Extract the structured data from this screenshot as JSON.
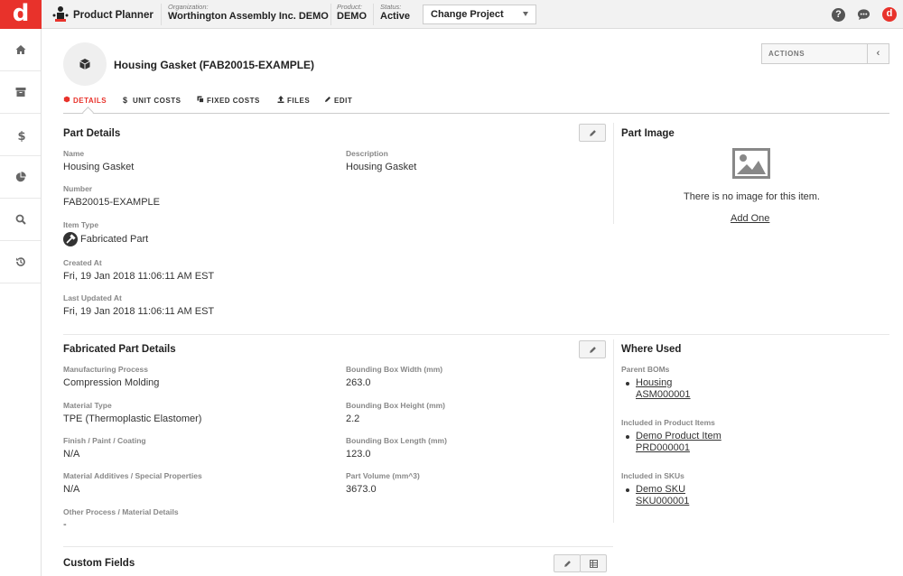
{
  "topbar": {
    "logo": "d",
    "app_name": "Product Planner",
    "organization_label": "Organization:",
    "organization": "Worthington Assembly Inc. DEMO",
    "product_label": "Product:",
    "product": "DEMO",
    "status_label": "Status:",
    "status": "Active",
    "change_project": "Change Project",
    "help": "?",
    "avatar": "d"
  },
  "sidebar": {
    "items": [
      "home-icon",
      "archive-icon",
      "dollar-icon",
      "pie-chart-icon",
      "search-icon",
      "history-icon"
    ]
  },
  "part": {
    "title": "Housing Gasket (FAB20015-EXAMPLE)"
  },
  "actions_label": "ACTIONS",
  "tabs": [
    {
      "label": "DETAILS",
      "icon": "part-icon",
      "active": true
    },
    {
      "label": "UNIT COSTS",
      "icon": "dollar-icon"
    },
    {
      "label": "FIXED COSTS",
      "icon": "copy-icon"
    },
    {
      "label": "FILES",
      "icon": "upload-icon"
    },
    {
      "label": "EDIT",
      "icon": "pencil-icon"
    }
  ],
  "part_details": {
    "title": "Part Details",
    "name_label": "Name",
    "name": "Housing Gasket",
    "description_label": "Description",
    "description": "Housing Gasket",
    "number_label": "Number",
    "number": "FAB20015-EXAMPLE",
    "item_type_label": "Item Type",
    "item_type": "Fabricated Part",
    "created_label": "Created At",
    "created": "Fri, 19 Jan 2018 11:06:11 AM EST",
    "updated_label": "Last Updated At",
    "updated": "Fri, 19 Jan 2018 11:06:11 AM EST"
  },
  "part_image": {
    "title": "Part Image",
    "empty_text": "There is no image for this item.",
    "add_link": "Add One"
  },
  "fabricated_details": {
    "title": "Fabricated Part Details",
    "mfg_label": "Manufacturing Process",
    "mfg": "Compression Molding",
    "material_label": "Material Type",
    "material": "TPE (Thermoplastic Elastomer)",
    "finish_label": "Finish / Paint / Coating",
    "finish": "N/A",
    "additives_label": "Material Additives / Special Properties",
    "additives": "N/A",
    "other_label": "Other Process / Material Details",
    "other": "-",
    "bbw_label": "Bounding Box Width (mm)",
    "bbw": "263.0",
    "bbh_label": "Bounding Box Height (mm)",
    "bbh": "2.2",
    "bbl_label": "Bounding Box Length (mm)",
    "bbl": "123.0",
    "volume_label": "Part Volume (mm^3)",
    "volume": "3673.0"
  },
  "where_used": {
    "title": "Where Used",
    "parent_boms_label": "Parent BOMs",
    "parent_bom_name": "Housing",
    "parent_bom_id": "ASM000001",
    "product_items_label": "Included in Product Items",
    "product_item_name": "Demo Product Item",
    "product_item_id": "PRD000001",
    "skus_label": "Included in SKUs",
    "sku_name": "Demo SKU",
    "sku_id": "SKU000001"
  },
  "custom_fields": {
    "title": "Custom Fields"
  }
}
